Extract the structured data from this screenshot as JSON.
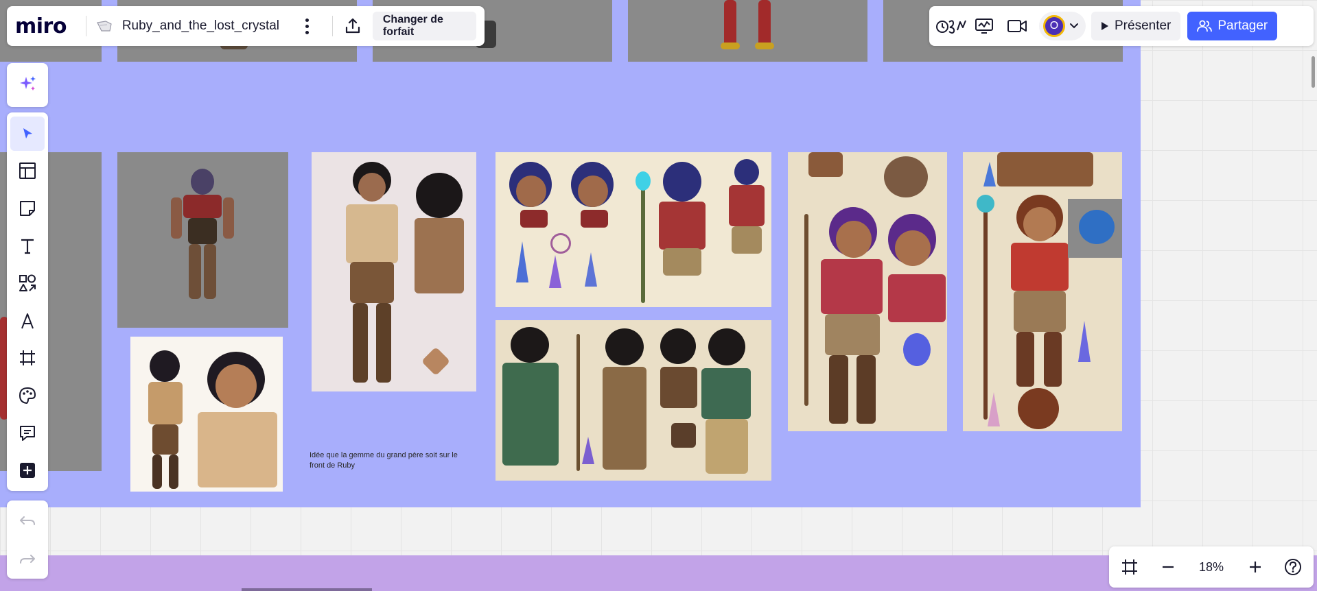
{
  "app": {
    "logo": "miro",
    "board_title": "Ruby_and_the_lost_crystal"
  },
  "header": {
    "plan_button": "Changer de forfait",
    "present_button": "Présenter",
    "share_button": "Partager",
    "avatar_initial": "O"
  },
  "canvas": {
    "note_text": "Idée que la gemme du grand père soit sur le front de Ruby",
    "frame_color": "#a8aefc",
    "bottom_frame_color": "#c2a3e8"
  },
  "toolbar": {
    "items": [
      "select",
      "templates",
      "sticky-note",
      "text",
      "shapes",
      "pen",
      "frame",
      "stickers",
      "comment",
      "more"
    ]
  },
  "zoom": {
    "level": "18%"
  },
  "colors": {
    "accent": "#4262ff",
    "avatar": "#4b2fb5",
    "avatar_ring": "#f2b705"
  }
}
